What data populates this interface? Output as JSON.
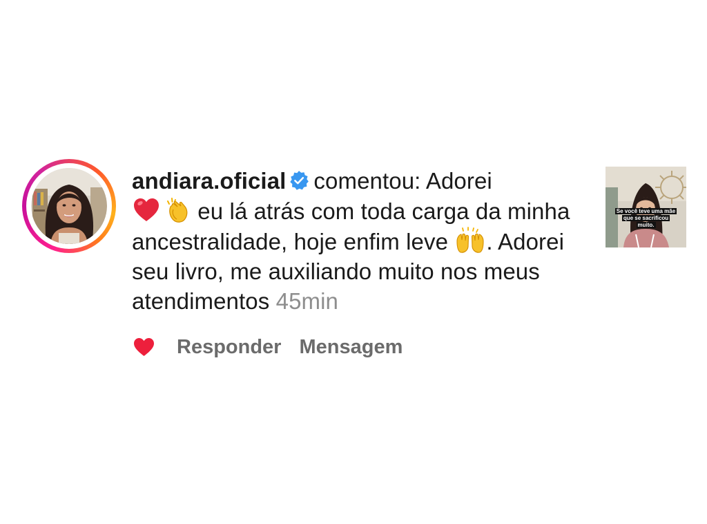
{
  "notification": {
    "username": "andiara.oficial",
    "verified_icon": "verified-badge-icon",
    "text": {
      "prefix": "comentou: Adorei",
      "emoji_heart": "❤️",
      "emoji_clap": "👏",
      "part2": "eu lá atrás com toda carga da minha ancestralidade, hoje enfim leve",
      "emoji_raised_hands": "🙌",
      "part3": ". Adorei seu livro, me auxiliando muito nos meus atendimentos"
    },
    "timestamp": "45min"
  },
  "actions": {
    "like_icon": "heart-icon",
    "reply_label": "Responder",
    "message_label": "Mensagem"
  },
  "post_thumbnail": {
    "caption_line1": "Se você teve uma mãe",
    "caption_line2": "que se sacrificou",
    "caption_line3": "muito."
  },
  "colors": {
    "like_red": "#ed1f3c",
    "verified_blue": "#3897f0",
    "timestamp_gray": "#8e8e8e",
    "action_gray": "#6b6b6b"
  }
}
